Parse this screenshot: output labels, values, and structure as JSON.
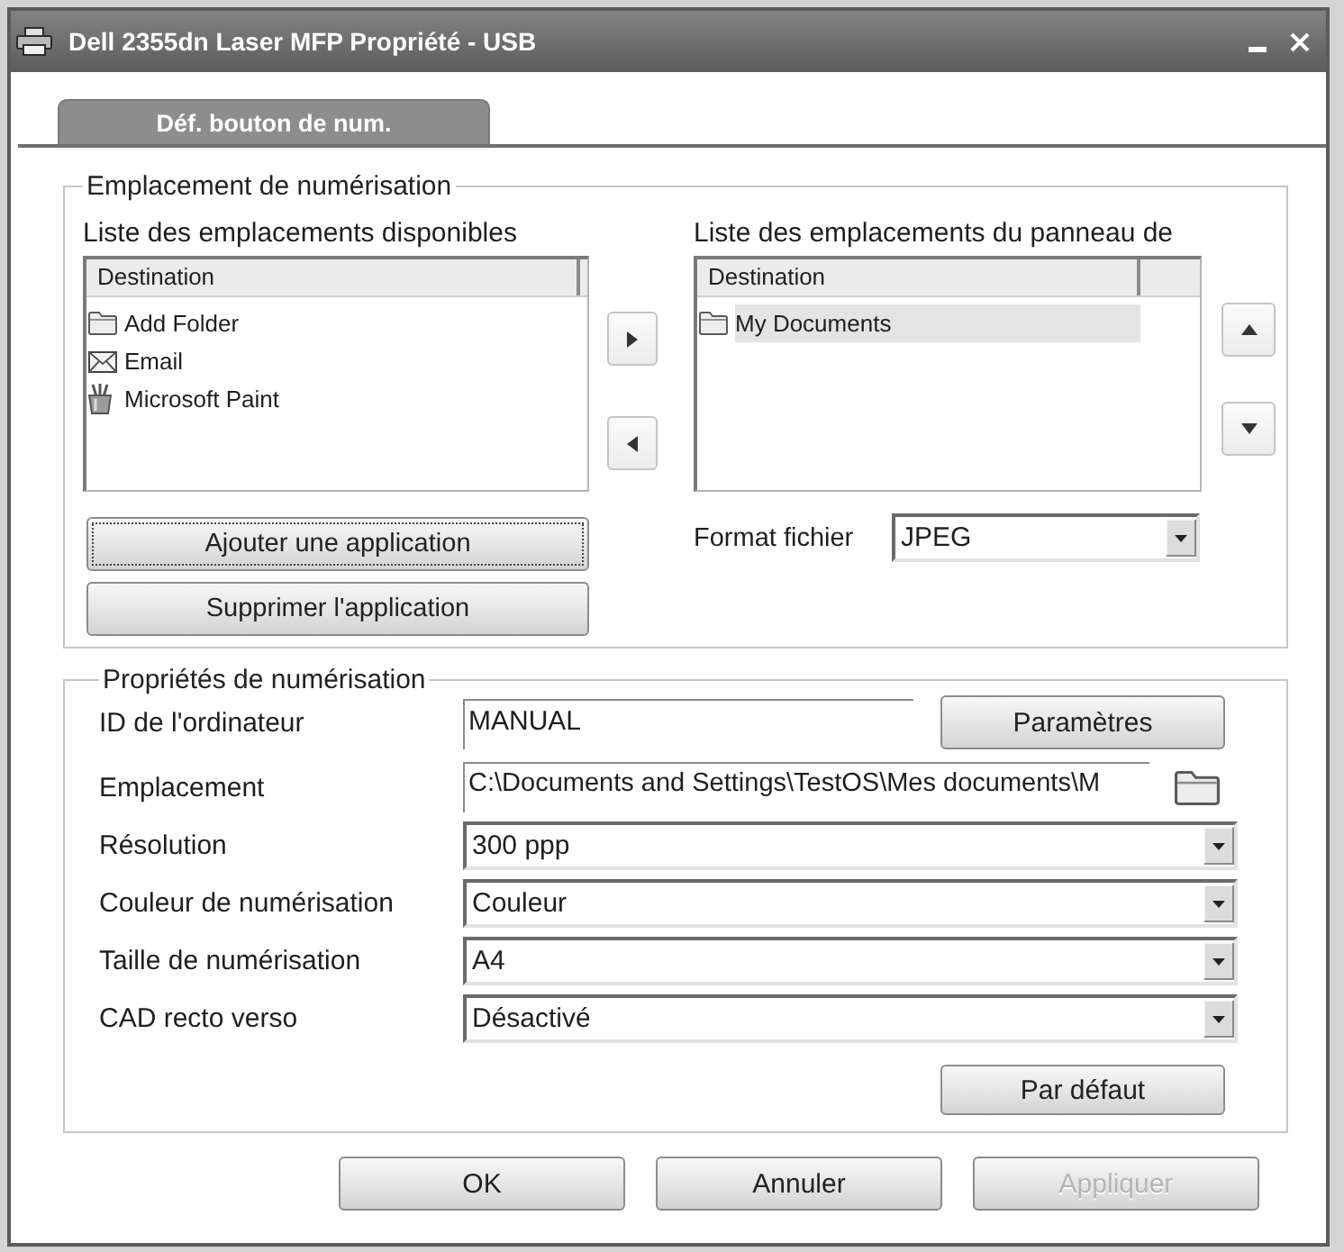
{
  "window": {
    "title": "Dell 2355dn Laser MFP Propriété - USB"
  },
  "tabs": [
    {
      "label": "Déf. bouton de num.",
      "selected": true
    }
  ],
  "location_group": {
    "title": "Emplacement de numérisation",
    "available_list": {
      "label": "Liste des emplacements disponibles",
      "columns": [
        "Destination"
      ],
      "items": [
        {
          "kind": "folder",
          "label": "Add Folder",
          "selected": false
        },
        {
          "kind": "email",
          "label": "Email",
          "selected": false
        },
        {
          "kind": "paint",
          "label": "Microsoft Paint",
          "selected": false
        }
      ]
    },
    "panel_list": {
      "label": "Liste des emplacements du panneau de",
      "columns": [
        "Destination"
      ],
      "items": [
        {
          "kind": "folder",
          "label": "My Documents",
          "selected": true
        }
      ]
    },
    "buttons": [
      {
        "label": "Ajouter une application",
        "focused": true
      },
      {
        "label": "Supprimer l'application",
        "focused": false
      }
    ],
    "file_format": {
      "label": "Format fichier",
      "value": "JPEG"
    }
  },
  "properties_group": {
    "title": "Propriétés de numérisation",
    "fields": [
      {
        "kind": "text",
        "label": "ID de l'ordinateur",
        "value": "MANUAL",
        "button": "Paramètres"
      },
      {
        "kind": "path",
        "label": "Emplacement",
        "value": "C:\\Documents and Settings\\TestOS\\Mes documents\\M"
      },
      {
        "kind": "select",
        "label": "Résolution",
        "value": "300 ppp"
      },
      {
        "kind": "select",
        "label": "Couleur de numérisation",
        "value": "Couleur"
      },
      {
        "kind": "select",
        "label": "Taille de numérisation",
        "value": "A4"
      },
      {
        "kind": "select",
        "label": "CAD recto verso",
        "value": "Désactivé"
      }
    ],
    "default_button": "Par défaut"
  },
  "buttons": [
    {
      "label": "OK",
      "disabled": false
    },
    {
      "label": "Annuler",
      "disabled": false
    },
    {
      "label": "Appliquer",
      "disabled": true
    }
  ]
}
